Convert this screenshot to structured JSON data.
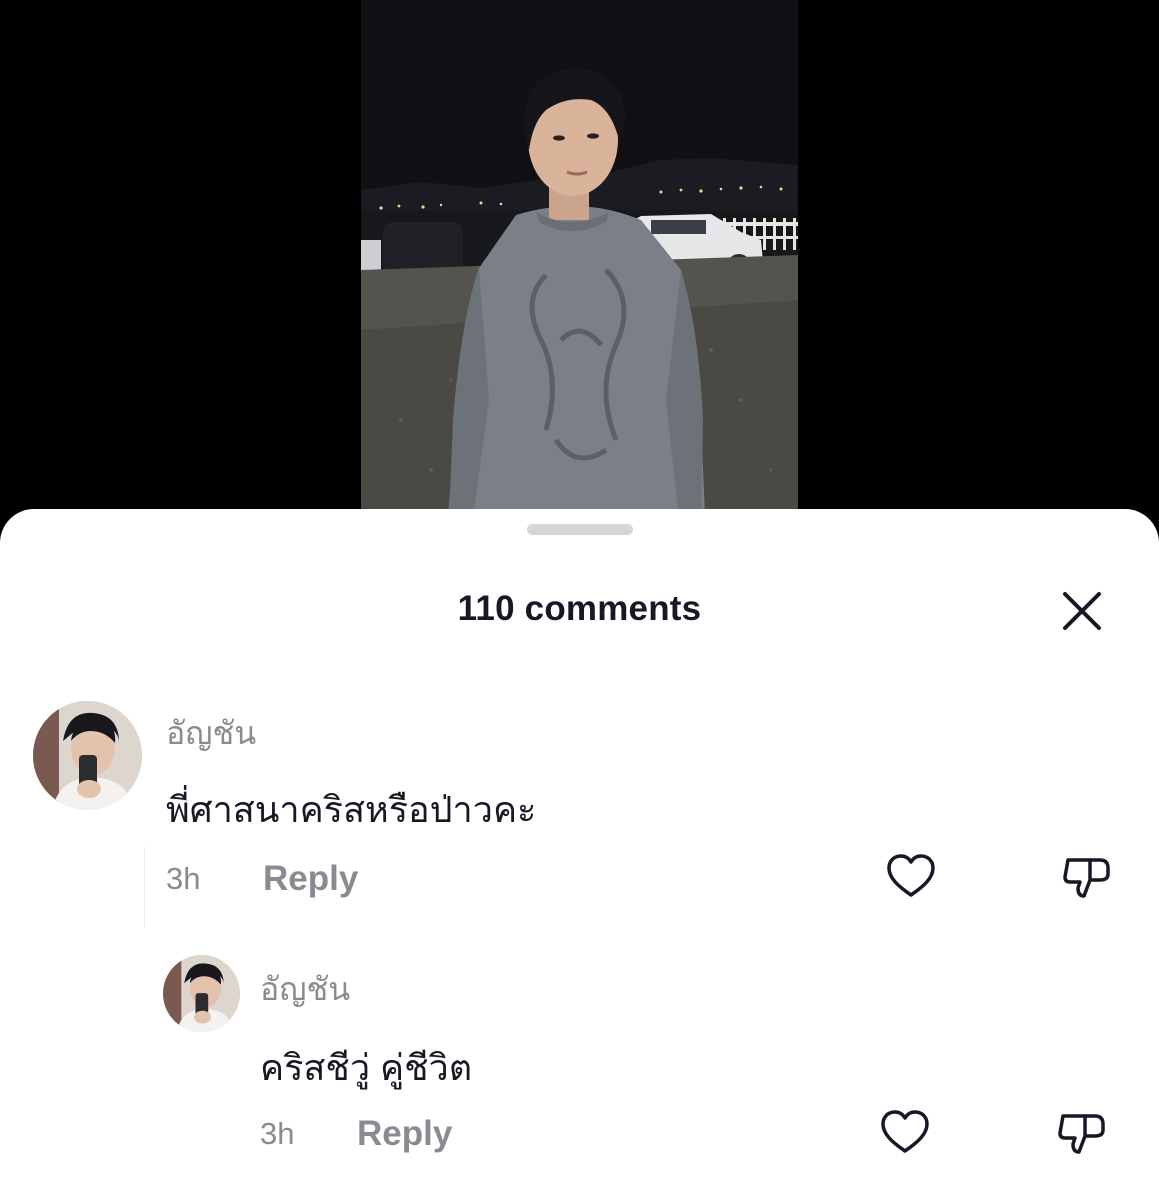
{
  "video": {
    "description_icon": "video-thumbnail"
  },
  "comments_panel": {
    "title": "110 comments",
    "close_icon": "close-icon"
  },
  "comments": [
    {
      "username": "อัญชัน",
      "text": "พี่ศาสนาคริสหรือป่าวคะ",
      "time": "3h",
      "reply_label": "Reply",
      "like_icon": "heart-icon",
      "dislike_icon": "thumbs-down-icon"
    }
  ],
  "replies": [
    {
      "username": "อัญชัน",
      "text": "คริสชีวู่ คู่ชีวิต",
      "time": "3h",
      "reply_label": "Reply",
      "like_icon": "heart-icon",
      "dislike_icon": "thumbs-down-icon"
    }
  ],
  "colors": {
    "text_primary": "#161823",
    "text_secondary": "#8a8b91",
    "sheet_bg": "#ffffff",
    "grabber": "#d6d6d6"
  }
}
